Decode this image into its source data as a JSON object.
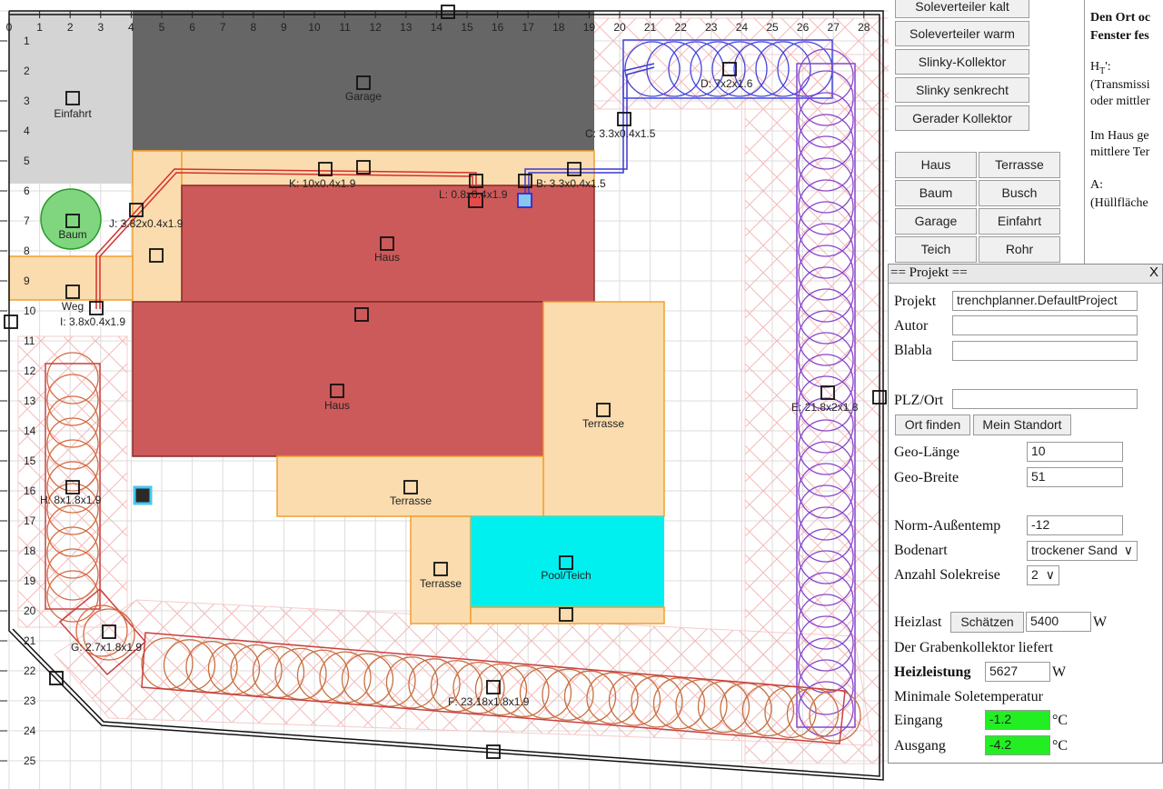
{
  "plan": {
    "x_ticks": [
      "0",
      "1",
      "2",
      "3",
      "4",
      "5",
      "6",
      "7",
      "8",
      "9",
      "10",
      "11",
      "12",
      "13",
      "14",
      "15",
      "16",
      "17",
      "18",
      "19",
      "20",
      "21",
      "22",
      "23",
      "24",
      "25",
      "26",
      "27",
      "28"
    ],
    "y_ticks": [
      "1",
      "2",
      "3",
      "4",
      "5",
      "6",
      "7",
      "8",
      "9",
      "10",
      "11",
      "12",
      "13",
      "14",
      "15",
      "16",
      "17",
      "18",
      "19",
      "20",
      "21",
      "22",
      "23",
      "24",
      "25"
    ],
    "areas": {
      "einfahrt": "Einfahrt",
      "garage": "Garage",
      "baum": "Baum",
      "weg": "Weg",
      "haus_upper": "Haus",
      "haus_lower": "Haus",
      "terrasse_right": "Terrasse",
      "terrasse_bottom": "Terrasse",
      "terrasse_small": "Terrasse",
      "pool": "Pool/Teich"
    },
    "trenches": {
      "c": "C: 3.3x0.4x1.5",
      "d": "D: 7x2x1.6",
      "e": "E: 21.8x2x1.8",
      "f": "F: 23.18x1.8x1.9",
      "g": "G: 2.7x1.8x1.9",
      "h": "H: 8x1.8x1.9",
      "i": "I: 3.8x0.4x1.9",
      "j": "J: 3.82x0.4x1.9",
      "k": "K: 10x0.4x1.9",
      "l": "L: 0.8x0.4x1.9",
      "b": "B: 3.3x0.4x1.5"
    }
  },
  "toolbar": {
    "buttons": [
      "Soleverteiler kalt",
      "Soleverteiler warm",
      "Slinky-Kollektor",
      "Slinky senkrecht",
      "Gerader Kollektor"
    ],
    "grid": [
      "Haus",
      "Terrasse",
      "Baum",
      "Busch",
      "Garage",
      "Einfahrt",
      "Teich",
      "Rohr"
    ]
  },
  "info": {
    "line1": "Den Ort oc",
    "line2": "Fenster fes",
    "ht": "H",
    "ht_sub": "T",
    "ht_tail": "':",
    "line3": "(Transmissi",
    "line4": "oder mittler",
    "line5": "Im Haus ge",
    "line6": "mittlere Ter",
    "line7": "A:",
    "line8": "(Hüllfläche"
  },
  "projekt": {
    "title": "== Projekt ==",
    "close": "X",
    "projekt_label": "Projekt",
    "projekt_value": "trenchplanner.DefaultProject",
    "autor_label": "Autor",
    "autor_value": "",
    "blabla_label": "Blabla",
    "blabla_value": "",
    "plz_label": "PLZ/Ort",
    "plz_value": "",
    "ort_finden": "Ort finden",
    "mein_standort": "Mein Standort",
    "geo_laenge_label": "Geo-Länge",
    "geo_laenge": "10",
    "geo_breite_label": "Geo-Breite",
    "geo_breite": "51",
    "norm_label": "Norm-Außentemp",
    "norm_value": "-12",
    "boden_label": "Bodenart",
    "boden_value": "trockener Sand",
    "kreise_label": "Anzahl Solekreise",
    "kreise_value": "2",
    "heizlast_label": "Heizlast",
    "schaetzen": "Schätzen",
    "heizlast_value": "5400",
    "unit_w": "W",
    "liefert": "Der Grabenkollektor liefert",
    "heizleistung_label": "Heizleistung",
    "heizleistung_value": "5627",
    "min_sole": "Minimale Soletemperatur",
    "eingang_label": "Eingang",
    "eingang_value": "-1.2",
    "ausgang_label": "Ausgang",
    "ausgang_value": "-4.2",
    "unit_c": "°C",
    "temp_color": "#22ee22"
  }
}
